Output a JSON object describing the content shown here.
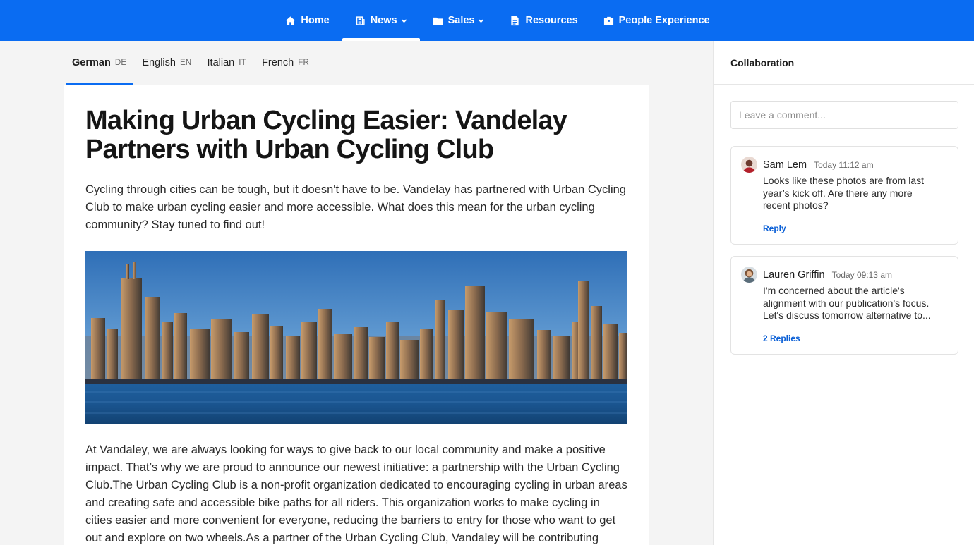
{
  "nav": {
    "items": [
      {
        "label": "Home",
        "icon": "home-icon",
        "active": false,
        "dropdown": false
      },
      {
        "label": "News",
        "icon": "newspaper-icon",
        "active": true,
        "dropdown": true
      },
      {
        "label": "Sales",
        "icon": "folder-icon",
        "active": false,
        "dropdown": true
      },
      {
        "label": "Resources",
        "icon": "document-icon",
        "active": false,
        "dropdown": false
      },
      {
        "label": "People Experience",
        "icon": "briefcase-icon",
        "active": false,
        "dropdown": false
      }
    ]
  },
  "language_tabs": [
    {
      "name": "German",
      "code": "DE",
      "active": true
    },
    {
      "name": "English",
      "code": "EN",
      "active": false
    },
    {
      "name": "Italian",
      "code": "IT",
      "active": false
    },
    {
      "name": "French",
      "code": "FR",
      "active": false
    }
  ],
  "article": {
    "title": "Making Urban Cycling Easier: Vandelay Partners with Urban Cycling Club",
    "intro": "Cycling through cities can be tough, but it doesn't have to be. Vandelay has partnered with Urban Cycling Club to make urban cycling easier and more accessible. What does this mean for the urban cycling community? Stay tuned to find out!",
    "body": "At Vandaley, we are always looking for ways to give back to our local community and make a positive impact. That’s why we are proud to announce our newest initiative: a partnership with the Urban Cycling Club.The Urban Cycling Club is a non-profit organization dedicated to encouraging cycling in urban areas and creating safe and accessible bike paths for all riders. This organization works to make cycling in cities easier and more convenient for everyone, reducing the barriers to entry for those who want to get out and explore on two wheels.As a partner of the Urban Cycling Club, Vandaley will be contributing"
  },
  "collaboration": {
    "title": "Collaboration",
    "comment_placeholder": "Leave a comment...",
    "comments": [
      {
        "author": "Sam Lem",
        "time": "Today 11:12 am",
        "text": "Looks like these photos are from last year’s kick off. Are there any more recent photos?",
        "action": "Reply"
      },
      {
        "author": "Lauren Griffin",
        "time": "Today 09:13 am",
        "text": "I'm concerned about the article's alignment with our publication's focus. Let's discuss tomorrow alternative to...",
        "action": "2 Replies"
      }
    ]
  },
  "colors": {
    "nav_background": "#0a6cf2",
    "accent": "#0a6cf2",
    "link": "#0a5fd6"
  }
}
